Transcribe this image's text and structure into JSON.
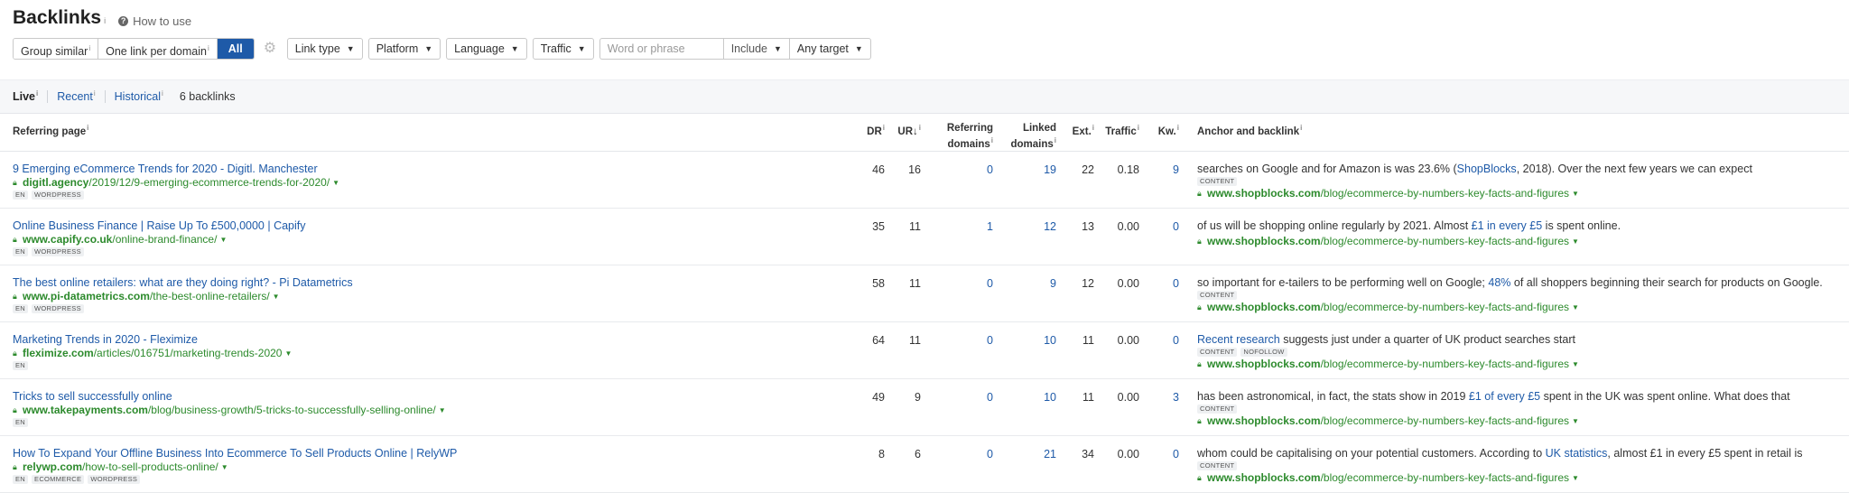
{
  "header": {
    "title": "Backlinks",
    "title_info": "i",
    "how_to_use": "How to use"
  },
  "toolbar": {
    "segments": [
      {
        "label": "Group similar",
        "info": "i"
      },
      {
        "label": "One link per domain",
        "info": "i"
      },
      {
        "label": "All",
        "info": ""
      }
    ],
    "link_type": "Link type",
    "platform": "Platform",
    "language": "Language",
    "traffic": "Traffic",
    "search_placeholder": "Word or phrase",
    "include": "Include",
    "any_target": "Any target"
  },
  "subtabs": {
    "live": "Live",
    "recent": "Recent",
    "historical": "Historical",
    "info": "i",
    "count": "6 backlinks"
  },
  "columns": {
    "referring_page": "Referring page",
    "dr": "DR",
    "ur": "UR",
    "ur_sort": "↓",
    "referring_domains": [
      "Referring",
      "domains"
    ],
    "linked_domains": [
      "Linked",
      "domains"
    ],
    "ext": "Ext.",
    "traffic": "Traffic",
    "kw": "Kw.",
    "anchor": "Anchor and backlink",
    "info": "i"
  },
  "rows": [
    {
      "title": "9 Emerging eCommerce Trends for 2020 - Digitl. Manchester",
      "domain": "digitl.agency",
      "path": "/2019/12/9-emerging-ecommerce-trends-for-2020/",
      "tags": [
        "EN",
        "WORDPRESS"
      ],
      "dr": "46",
      "ur": "16",
      "ref_domains": "0",
      "linked_domains": "19",
      "ext": "22",
      "traffic": "0.18",
      "kw": "9",
      "anchor_pre": "searches on Google and for Amazon is was 23.6% (",
      "anchor_link": "ShopBlocks",
      "anchor_post": ", 2018). Over the next few years we can expect",
      "anchor_tags": [
        "CONTENT"
      ],
      "target_domain": "www.shopblocks.com",
      "target_path": "/blog/ecommerce-by-numbers-key-facts-and-figures"
    },
    {
      "title": "Online Business Finance | Raise Up To £500,0000 | Capify",
      "domain": "www.capify.co.uk",
      "path": "/online-brand-finance/",
      "tags": [
        "EN",
        "WORDPRESS"
      ],
      "dr": "35",
      "ur": "11",
      "ref_domains": "1",
      "linked_domains": "12",
      "ext": "13",
      "traffic": "0.00",
      "kw": "0",
      "anchor_pre": "of us will be shopping online regularly by 2021. Almost ",
      "anchor_link": "£1 in every £5",
      "anchor_post": " is spent online.",
      "anchor_tags": [],
      "target_domain": "www.shopblocks.com",
      "target_path": "/blog/ecommerce-by-numbers-key-facts-and-figures"
    },
    {
      "title": "The best online retailers: what are they doing right? - Pi Datametrics",
      "domain": "www.pi-datametrics.com",
      "path": "/the-best-online-retailers/",
      "tags": [
        "EN",
        "WORDPRESS"
      ],
      "dr": "58",
      "ur": "11",
      "ref_domains": "0",
      "linked_domains": "9",
      "ext": "12",
      "traffic": "0.00",
      "kw": "0",
      "anchor_pre": "so important for e-tailers to be performing well on Google; ",
      "anchor_link": "48%",
      "anchor_post": " of all shoppers beginning their search for products on Google.",
      "anchor_tags": [
        "CONTENT"
      ],
      "target_domain": "www.shopblocks.com",
      "target_path": "/blog/ecommerce-by-numbers-key-facts-and-figures"
    },
    {
      "title": "Marketing Trends in 2020 - Fleximize",
      "domain": "fleximize.com",
      "path": "/articles/016751/marketing-trends-2020",
      "tags": [
        "EN"
      ],
      "dr": "64",
      "ur": "11",
      "ref_domains": "0",
      "linked_domains": "10",
      "ext": "11",
      "traffic": "0.00",
      "kw": "0",
      "anchor_pre": "",
      "anchor_link": "Recent research",
      "anchor_post": " suggests just under a quarter of UK product searches start",
      "anchor_tags": [
        "CONTENT",
        "NOFOLLOW"
      ],
      "target_domain": "www.shopblocks.com",
      "target_path": "/blog/ecommerce-by-numbers-key-facts-and-figures"
    },
    {
      "title": "Tricks to sell successfully online",
      "domain": "www.takepayments.com",
      "path": "/blog/business-growth/5-tricks-to-successfully-selling-online/",
      "tags": [
        "EN"
      ],
      "dr": "49",
      "ur": "9",
      "ref_domains": "0",
      "linked_domains": "10",
      "ext": "11",
      "traffic": "0.00",
      "kw": "3",
      "anchor_pre": "has been astronomical, in fact, the stats show in 2019 ",
      "anchor_link": "£1 of every £5",
      "anchor_post": " spent in the UK was spent online. What does that",
      "anchor_tags": [
        "CONTENT"
      ],
      "target_domain": "www.shopblocks.com",
      "target_path": "/blog/ecommerce-by-numbers-key-facts-and-figures"
    },
    {
      "title": "How To Expand Your Offline Business Into Ecommerce To Sell Products Online | RelyWP",
      "domain": "relywp.com",
      "path": "/how-to-sell-products-online/",
      "tags": [
        "EN",
        "ECOMMERCE",
        "WORDPRESS"
      ],
      "dr": "8",
      "ur": "6",
      "ref_domains": "0",
      "linked_domains": "21",
      "ext": "34",
      "traffic": "0.00",
      "kw": "0",
      "anchor_pre": "whom could be capitalising on your potential customers. According to ",
      "anchor_link": "UK statistics",
      "anchor_post": ", almost £1 in every £5 spent in retail is",
      "anchor_tags": [
        "CONTENT"
      ],
      "target_domain": "www.shopblocks.com",
      "target_path": "/blog/ecommerce-by-numbers-key-facts-and-figures"
    }
  ]
}
